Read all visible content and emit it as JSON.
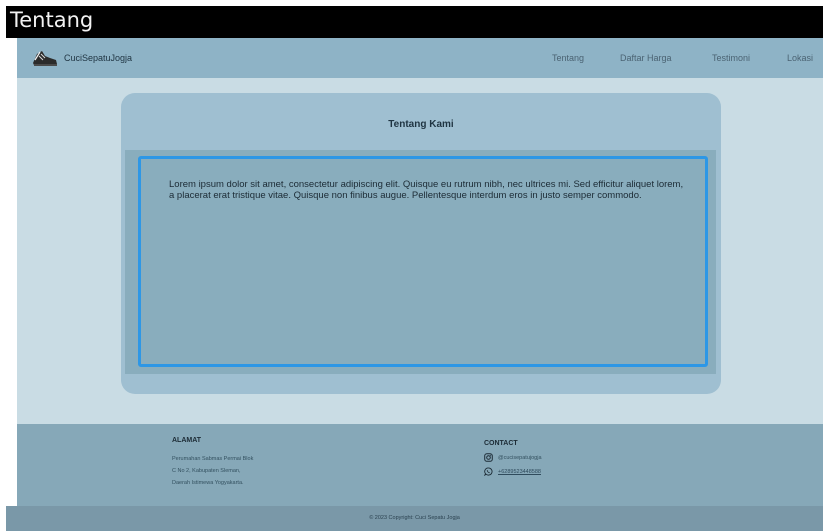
{
  "window": {
    "title": "Tentang"
  },
  "navbar": {
    "brand": "CuciSepatuJogja",
    "links": [
      "Tentang",
      "Daftar Harga",
      "Testimoni",
      "Lokasi"
    ]
  },
  "about": {
    "title": "Tentang Kami",
    "body": "Lorem ipsum dolor sit amet, consectetur adipiscing elit. Quisque eu rutrum nibh, nec ultrices mi. Sed efficitur aliquet lorem, a placerat erat tristique vitae. Quisque non finibus augue. Pellentesque interdum eros in justo semper commodo."
  },
  "footer": {
    "alamat": {
      "heading": "ALAMAT",
      "lines": [
        "Perumahan Sabmas Permai Blok",
        "C No 2, Kabupaten Sleman,",
        "Daerah Istimewa Yogyakarta."
      ]
    },
    "contact": {
      "heading": "CONTACT",
      "instagram": "@cucisepatujogja",
      "whatsapp": "+6289523448588"
    },
    "copyright": "© 2023 Copyright: Cuci Sepatu Jogja"
  },
  "colors": {
    "navbar": "#8eb3c6",
    "page_background": "#c9dce4",
    "card": "#9fbfd1",
    "card_body": "#89adbd",
    "focus_border": "#2d97e6",
    "footer": "#86a8b8"
  }
}
